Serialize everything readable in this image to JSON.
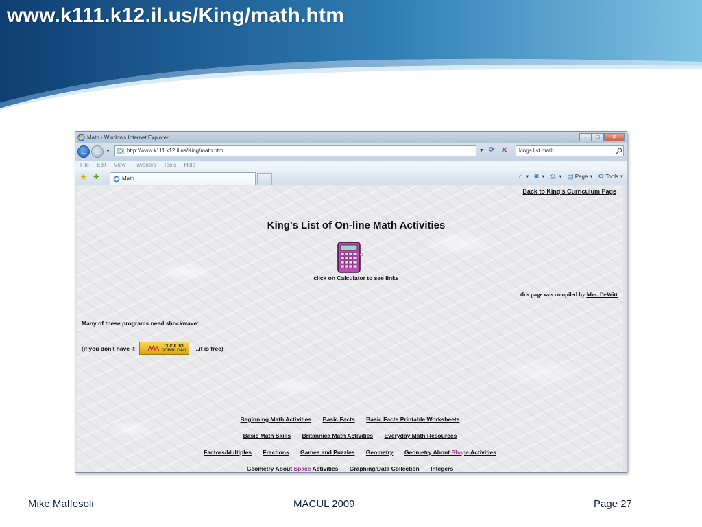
{
  "slide": {
    "title": "www.k111.k12.il.us/King/math.htm",
    "footer_author": "Mike Maffesoli",
    "footer_event": "MACUL 2009",
    "footer_page": "Page 27",
    "header_colors": [
      "#0f3e72",
      "#2e7db4",
      "#7fc2e2"
    ]
  },
  "browser": {
    "window_title": "Math - Windows Internet Explorer",
    "address": "http://www.k111.k12.il.us/King/math.htm",
    "search_text": "kings list math",
    "menu": [
      "File",
      "Edit",
      "View",
      "Favorites",
      "Tools",
      "Help"
    ],
    "tab_label": "Math",
    "commands": {
      "page": "Page",
      "tools": "Tools"
    }
  },
  "page": {
    "back_link": "Back to King's Curriculum Page",
    "heading": "King's List of On-line Math Activities",
    "calculator_caption": "click on Calculator to see links",
    "compiled_prefix": "this page was compiled by ",
    "compiled_author": "Mrs. DeWitt",
    "shockwave_note": "Many of these programs need shockwave:",
    "shockwave_prefix": "(if you don't have it",
    "download_label_1": "CLICK TO",
    "download_label_2": "DOWNLOAD",
    "shockwave_suffix": "..it is free)",
    "links": {
      "beginning_math": "Beginning Math Activities",
      "basic_facts": "Basic Facts",
      "basic_facts_printable": "Basic Facts Printable Worksheets",
      "basic_math_skills": "Basic Math Skills",
      "britannica": "Britannica Math Activities",
      "everyday_math": "Everyday Math Resources",
      "factors": "Factors/Multiples",
      "fractions": "Fractions",
      "games": "Games and Puzzles",
      "geometry": "Geometry",
      "geometry_shape_prefix": "Geometry About ",
      "geometry_shape_word": "Shape",
      "geometry_shape_suffix": " Activities",
      "geometry_space_prefix": "Geometry About ",
      "geometry_space_word": "Space",
      "geometry_space_suffix": " Activities",
      "graphing": "Graphing/Data Collection",
      "integers": "Integers"
    }
  }
}
